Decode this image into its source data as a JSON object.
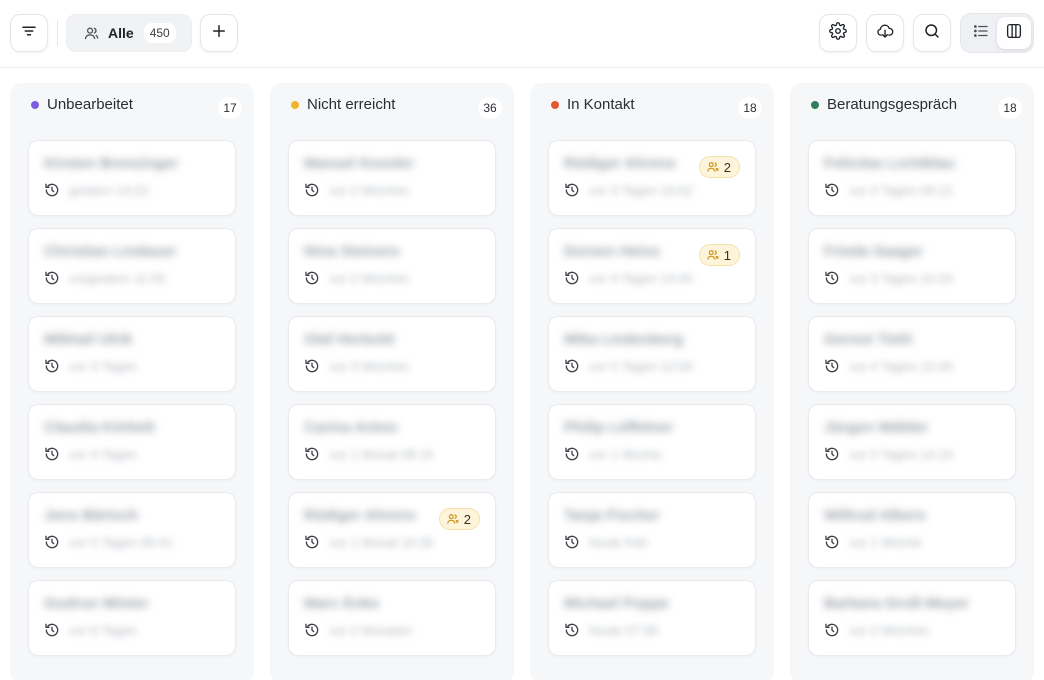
{
  "toolbar": {
    "filter_button_icon": "filter-lines-icon",
    "view_filter": {
      "icon": "users-icon",
      "label": "Alle",
      "count": "450"
    },
    "add_button_icon": "plus-icon",
    "settings_icon": "gear-icon",
    "export_icon": "cloud-download-icon",
    "search_icon": "search-icon",
    "view_modes": [
      {
        "name": "list",
        "icon": "list-icon",
        "active": false
      },
      {
        "name": "board",
        "icon": "columns-icon",
        "active": true
      }
    ]
  },
  "colors": {
    "unbearbeitet": "#7c5ce0",
    "nicht_erreicht": "#f0b429",
    "in_kontakt": "#e4572e",
    "beratungsgespraech": "#2f7d5b",
    "badge_bg": "#fdf4dc"
  },
  "columns": [
    {
      "title": "Unbearbeitet",
      "count": "17",
      "dot_color": "#7c5ce0",
      "cards": [
        {
          "name": "Kirsten Brenzinger",
          "date": "gestern 14:22",
          "badge": ""
        },
        {
          "name": "Christian Lindauer",
          "date": "vorgestern 11:05",
          "badge": ""
        },
        {
          "name": "Mikhail Ulrik",
          "date": "vor 3 Tagen",
          "badge": ""
        },
        {
          "name": "Claudia Körbelt",
          "date": "vor 4 Tagen",
          "badge": ""
        },
        {
          "name": "Jens Bärtsch",
          "date": "vor 5 Tagen 09:41",
          "badge": ""
        },
        {
          "name": "Gudrun Winter",
          "date": "vor 6 Tagen",
          "badge": ""
        }
      ]
    },
    {
      "title": "Nicht erreicht",
      "count": "36",
      "dot_color": "#f0b429",
      "cards": [
        {
          "name": "Manuel Kessler",
          "date": "vor 2 Wochen",
          "badge": ""
        },
        {
          "name": "Nina Steiners",
          "date": "vor 2 Wochen",
          "badge": ""
        },
        {
          "name": "Olaf Herbold",
          "date": "vor 3 Wochen",
          "badge": ""
        },
        {
          "name": "Carina Anton",
          "date": "vor 1 Monat 08:15",
          "badge": ""
        },
        {
          "name": "Rüdiger Ahrens",
          "date": "vor 1 Monat 10:30",
          "badge": "2"
        },
        {
          "name": "Marc Enke",
          "date": "vor 2 Monaten",
          "badge": ""
        }
      ]
    },
    {
      "title": "In Kontakt",
      "count": "18",
      "dot_color": "#e4572e",
      "cards": [
        {
          "name": "Rüdiger Ahrens",
          "date": "vor 3 Tagen 16:02",
          "badge": "2"
        },
        {
          "name": "Doreen Heinz",
          "date": "vor 4 Tagen 13:45",
          "badge": "1"
        },
        {
          "name": "Mika Lindenberg",
          "date": "vor 5 Tagen 12:00",
          "badge": ""
        },
        {
          "name": "Philip Löffelner",
          "date": "vor 1 Woche",
          "badge": ""
        },
        {
          "name": "Tanja Fischer",
          "date": "heute früh",
          "badge": ""
        },
        {
          "name": "Michael Poppe",
          "date": "heute 07:58",
          "badge": ""
        }
      ]
    },
    {
      "title": "Beratungsgespräch",
      "count": "18",
      "dot_color": "#2f7d5b",
      "cards": [
        {
          "name": "Felicitas Lichtblau",
          "date": "vor 2 Tagen 09:12",
          "badge": ""
        },
        {
          "name": "Frieda Saager",
          "date": "vor 3 Tagen 10:20",
          "badge": ""
        },
        {
          "name": "Gernot Tiehl",
          "date": "vor 4 Tagen 15:30",
          "badge": ""
        },
        {
          "name": "Jürgen Wälder",
          "date": "vor 5 Tagen 14:10",
          "badge": ""
        },
        {
          "name": "Wiltrud Albers",
          "date": "vor 1 Woche",
          "badge": ""
        },
        {
          "name": "Barbara Groß-Meyer",
          "date": "vor 2 Wochen",
          "badge": ""
        }
      ]
    }
  ]
}
